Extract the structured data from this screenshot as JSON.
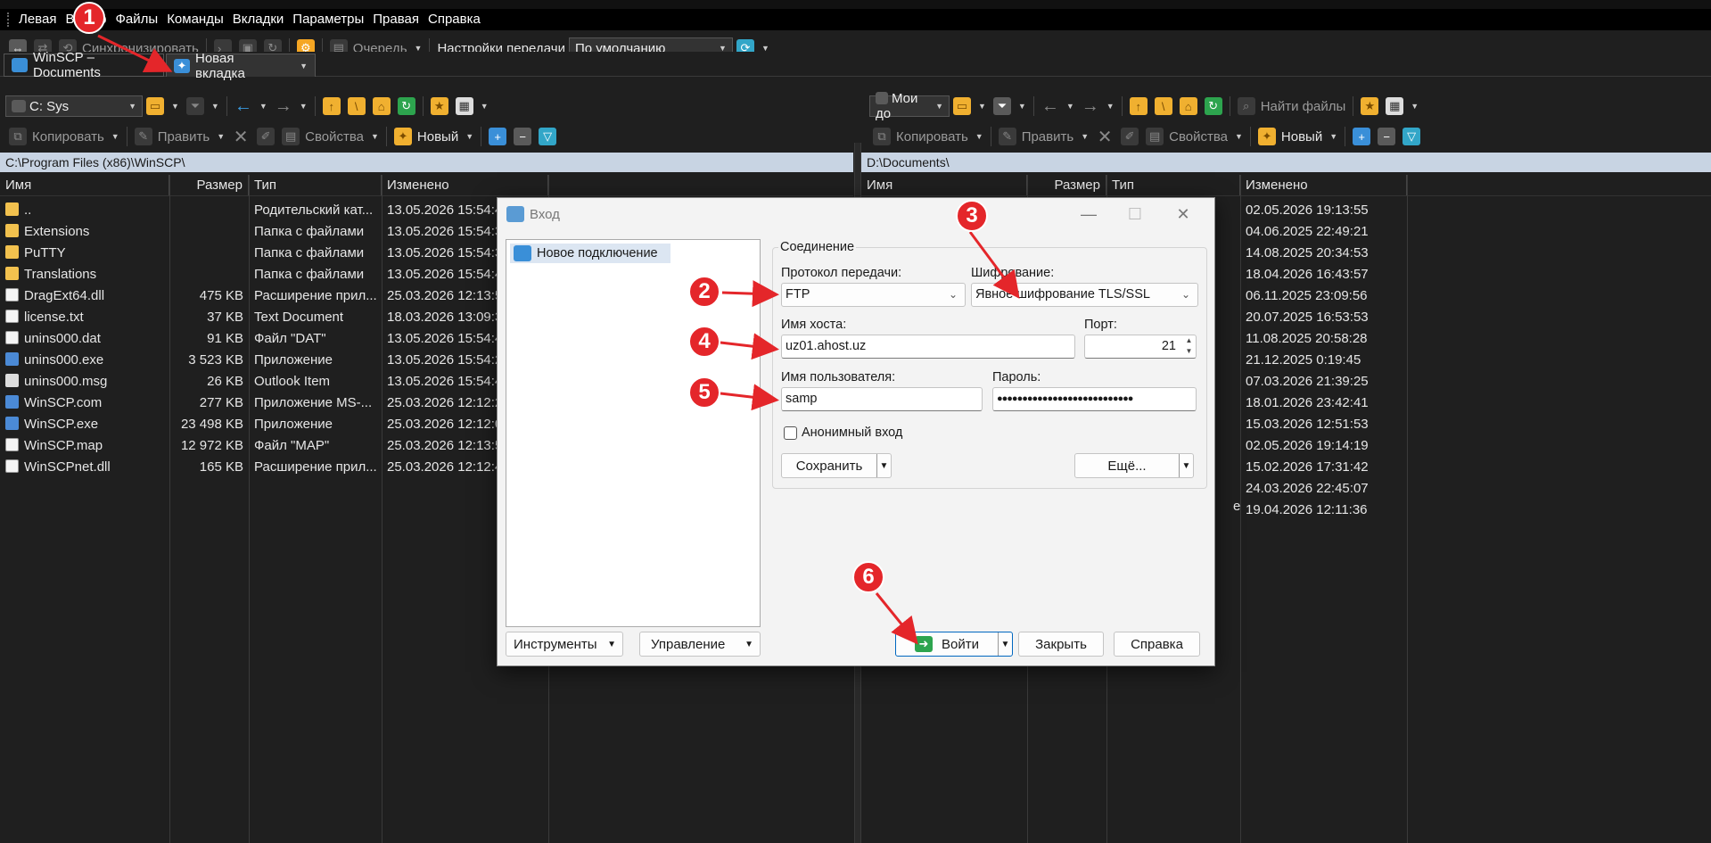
{
  "menu": [
    "Левая",
    "Выбор",
    "Файлы",
    "Команды",
    "Вкладки",
    "Параметры",
    "Правая",
    "Справка"
  ],
  "toolbar": {
    "sync_label": "Синхронизировать",
    "queue_label": "Очередь",
    "transfer_settings_label": "Настройки передачи",
    "transfer_settings_value": "По умолчанию"
  },
  "tabs": [
    {
      "label": "WinSCP – Documents"
    },
    {
      "label": "Новая вкладка"
    }
  ],
  "left_panel": {
    "drive": "C: Sys",
    "copy_label": "Копировать",
    "edit_label": "Править",
    "properties_label": "Свойства",
    "new_label": "Новый",
    "path": "C:\\Program Files (x86)\\WinSCP\\",
    "columns": [
      "Имя",
      "Размер",
      "Тип",
      "Изменено"
    ],
    "files": [
      {
        "name": "..",
        "size": "",
        "type": "Родительский кат...",
        "modified": "13.05.2026 15:54:46",
        "icon": "folder-up"
      },
      {
        "name": "Extensions",
        "size": "",
        "type": "Папка с файлами",
        "modified": "13.05.2026 15:54:39",
        "icon": "folder"
      },
      {
        "name": "PuTTY",
        "size": "",
        "type": "Папка с файлами",
        "modified": "13.05.2026 15:54:39",
        "icon": "folder"
      },
      {
        "name": "Translations",
        "size": "",
        "type": "Папка с файлами",
        "modified": "13.05.2026 15:54:40",
        "icon": "folder"
      },
      {
        "name": "DragExt64.dll",
        "size": "475 KB",
        "type": "Расширение прил...",
        "modified": "25.03.2026 12:13:52",
        "icon": "dll"
      },
      {
        "name": "license.txt",
        "size": "37 KB",
        "type": "Text Document",
        "modified": "18.03.2026 13:09:30",
        "icon": "doc"
      },
      {
        "name": "unins000.dat",
        "size": "91 KB",
        "type": "Файл \"DAT\"",
        "modified": "13.05.2026 15:54:40",
        "icon": "doc"
      },
      {
        "name": "unins000.exe",
        "size": "3 523 KB",
        "type": "Приложение",
        "modified": "13.05.2026 15:54:29",
        "icon": "exe"
      },
      {
        "name": "unins000.msg",
        "size": "26 KB",
        "type": "Outlook Item",
        "modified": "13.05.2026 15:54:40",
        "icon": "mail"
      },
      {
        "name": "WinSCP.com",
        "size": "277 KB",
        "type": "Приложение MS-...",
        "modified": "25.03.2026 12:12:24",
        "icon": "exe"
      },
      {
        "name": "WinSCP.exe",
        "size": "23 498 KB",
        "type": "Приложение",
        "modified": "25.03.2026 12:12:06",
        "icon": "exe"
      },
      {
        "name": "WinSCP.map",
        "size": "12 972 KB",
        "type": "Файл \"MAP\"",
        "modified": "25.03.2026 12:13:58",
        "icon": "doc"
      },
      {
        "name": "WinSCPnet.dll",
        "size": "165 KB",
        "type": "Расширение прил...",
        "modified": "25.03.2026 12:12:42",
        "icon": "dll"
      }
    ]
  },
  "right_panel": {
    "drive": "Мои до",
    "find_files_label": "Найти файлы",
    "copy_label": "Копировать",
    "edit_label": "Править",
    "properties_label": "Свойства",
    "new_label": "Новый",
    "path": "D:\\Documents\\",
    "columns": [
      "Имя",
      "Размер",
      "Тип",
      "Изменено"
    ],
    "modified": [
      "02.05.2026 19:13:55",
      "04.06.2025 22:49:21",
      "14.08.2025 20:34:53",
      "18.04.2026 16:43:57",
      "06.11.2025 23:09:56",
      "20.07.2025 16:53:53",
      "11.08.2025 20:58:28",
      "21.12.2025 0:19:45",
      "07.03.2026 21:39:25",
      "18.01.2026 23:42:41",
      "15.03.2026 12:51:53",
      "02.05.2026 19:14:19",
      "15.02.2026 17:31:42",
      "24.03.2026 22:45:07",
      "19.04.2026 12:11:36"
    ],
    "type_fragment": "e"
  },
  "dialog": {
    "title": "Вход",
    "site_item": "Новое подключение",
    "group_label": "Соединение",
    "protocol_label": "Протокол передачи:",
    "protocol_value": "FTP",
    "encryption_label": "Шифрование:",
    "encryption_value": "Явное шифрование TLS/SSL",
    "host_label": "Имя хоста:",
    "host_value": "uz01.ahost.uz",
    "port_label": "Порт:",
    "port_value": "21",
    "user_label": "Имя пользователя:",
    "user_value": "samp",
    "password_label": "Пароль:",
    "password_value": "●●●●●●●●●●●●●●●●●●●●●●●●●●●",
    "anonymous_label": "Анонимный вход",
    "save_label": "Сохранить",
    "more_label": "Ещё...",
    "tools_label": "Инструменты",
    "manage_label": "Управление",
    "login_label": "Войти",
    "close_label": "Закрыть",
    "help_label": "Справка"
  },
  "annotations": [
    "1",
    "2",
    "3",
    "4",
    "5",
    "6"
  ],
  "colors": {
    "annotation": "#e4262a",
    "path_bar": "#c8d4e3",
    "dialog_bg": "#f3f3f3"
  }
}
